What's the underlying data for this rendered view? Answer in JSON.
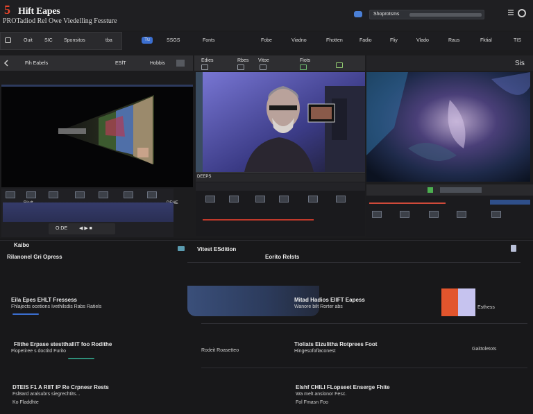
{
  "header": {
    "logo_number": "5",
    "logo_title": "Hift Eapes",
    "logo_subtitle": "PROTadiod Rel Owe Viedelling Fessture",
    "search_text": "Shoprotsms"
  },
  "nav": {
    "items": [
      "Ouit",
      "SIC",
      "Sponsitos",
      "tba",
      "Tu",
      "SSGS",
      "Fonts",
      "Fobe",
      "Viadno",
      "Fhotten",
      "Fadio",
      "Fliy",
      "Vlado",
      "Raus",
      "Fktial",
      "TIS"
    ]
  },
  "panels": {
    "left_header": [
      "Fih Eabels",
      "ESfT",
      "Hobbis"
    ],
    "mid_header": [
      "Edies",
      "Rbes",
      "Vitoe",
      "Fiots"
    ],
    "right_header_label": "Sis",
    "mid_timeline_label": "DEEPS",
    "left_timeline_labels": [
      "Ricdt",
      "DEHE"
    ],
    "left_ctrl_label": "O:DE"
  },
  "content": {
    "section_title": "Kaibo",
    "section_subtitle": "Rilanonel Gri Opress",
    "mid_title": "Vitest ESdition",
    "mid_sub": "Eorito Relsts",
    "block1_title": "Eila Epes EHLT Fressess",
    "block1_sub": "Fhlajects ocetions  Ivethilsdis Rabs Ratiels",
    "block2_title": "Mitad Hadios EIIFT Eapess",
    "block2_sub": "Wanore bilt  Rorter abs",
    "swatch_label": "Esthess",
    "block3_title": "Flithe Erpase stestthalliT foo Rodithe",
    "block3_sub": "Flopetiree s doctitd Furito",
    "block3_mid": "Rodeit Roasetteo",
    "block4_title": "Tioliats Eizulitha Rotprees Foot",
    "block4_sub": "Hingesofoflaconest",
    "block4_right": "Gaittoletots",
    "block5_title": "DTEIS F1 A RIIT IP Re Crpnesr Rests",
    "block5_sub": "Fsl8ard aralsubrs siegrechtits...",
    "block5_small": "Ko Fladdhte",
    "block6_title": "Elshf CHILI FLopseet Enserge Fhite",
    "block6_sub": "Wa melt anslonor Fesc.",
    "block6_small": "Fol Fmasn Foo"
  },
  "colors": {
    "accent_blue": "#3b6fd1",
    "logo_red": "#e8452b",
    "swatch_orange": "#e2552d",
    "swatch_lavender": "#c6c3ef"
  }
}
